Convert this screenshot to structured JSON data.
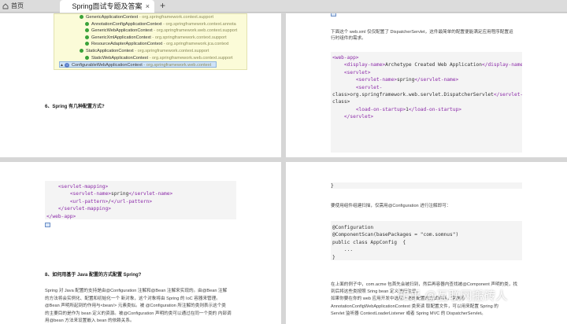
{
  "tabs": {
    "home_label": "首页",
    "active_label": "Spring面试专题及答案",
    "close_glyph": "×",
    "add_glyph": "+"
  },
  "page1": {
    "tree": [
      {
        "name": "GenericApplicationContext",
        "pkg": "- org.springframework.context.support",
        "indent": 2,
        "dot": true
      },
      {
        "name": "AnnotationConfigApplicationContext",
        "pkg": "- org.springframework.context.annota",
        "indent": 3,
        "dot": true
      },
      {
        "name": "GenericWebApplicationContext",
        "pkg": "- org.springframework.web.context.support",
        "indent": 3,
        "dot": true
      },
      {
        "name": "GenericXmlApplicationContext",
        "pkg": "- org.springframework.context.support",
        "indent": 3,
        "dot": true
      },
      {
        "name": "ResourceAdapterApplicationContext",
        "pkg": "- org.springframework.jca.context",
        "indent": 3,
        "dot": true
      },
      {
        "name": "StaticApplicationContext",
        "pkg": "- org.springframework.context.support",
        "indent": 2,
        "dot": true
      },
      {
        "name": "StaticWebApplicationContext",
        "pkg": "- org.springframework.web.context.support",
        "indent": 3,
        "dot": true
      },
      {
        "name": "ConfigurableWebApplicationContext",
        "pkg": "- org.springframework.web.context",
        "indent": 0,
        "dot": false
      }
    ],
    "heading": "6、Spring 有几种配置方式?"
  },
  "page2": {
    "intro_line1": "下面这个 web.xml 仅仅配置了 DispatcherServlet，这件最简单的配置便能满足应用程序配置运",
    "intro_line2": "行时组件的需求。",
    "code_lines": [
      "<web-app>",
      "    <display-name>Archetype Created Web Application</display-name>",
      "    <servlet>",
      "        <servlet-name>spring</servlet-name>",
      "        <servlet-",
      "class>org.springframework.web.servlet.DispatcherServlet</servlet-",
      "class>",
      "        <load-on-startup>1</load-on-startup>",
      "    </servlet>"
    ]
  },
  "page3": {
    "code_lines": [
      "    <servlet-mapping>",
      "        <servlet-name>spring</servlet-name>",
      "        <url-pattern>/</url-pattern>",
      "    </servlet-mapping>",
      "</web-app>"
    ],
    "heading": "8、如何用基于 Java 配置的方式配置 Spring?",
    "para_lines": [
      "Spring 对 Java 配置的支持是由@Configuration 注解和@Bean 注解来实现的。由@Bean 注解",
      "的方法将会实例化、配置和初始化一个 新对象，这个对象将由 Spring 的 IoC 容器来管理。",
      "@Bean 声明所起到的作用与<bean/> 元素类似。被 @Configuration 所注解的类则表示这个类",
      "的主要目的是作为 bean 定义的资源。被@Configuration 声明的类可以通过在同一个类的 内部调",
      "用@bean 方法来设置嵌入 bean 的依赖关系。"
    ]
  },
  "page4": {
    "brace_top": "}",
    "intro": "要使用组件组建扫描，仅需用@Configuration 进行注解即可：",
    "code_lines": [
      "@Configuration",
      "@ComponentScan(basePackages = \"com.somnus\")",
      "public class AppConfig  {",
      "    ...",
      "}"
    ],
    "para_lines": [
      "在上面的例子中，com.acme 包首先会被扫到，然后再容器内查找被@Component 声明的类，找",
      "到后将这些类按照 Sring bean 定义进行注册。",
      "如果你要在你的 web 应用开发中选用上述的配置的方式的话，需要用",
      "AnnotationConfigWebApplicationContext 类来读 取配置文件，可以用来配置 Spring 的",
      "Servlet 监听器 ContextLoaderListener 或者 Spring MVC 的 DispatcherServlet。"
    ]
  },
  "watermark": "知乎 @互联网搬砖人"
}
